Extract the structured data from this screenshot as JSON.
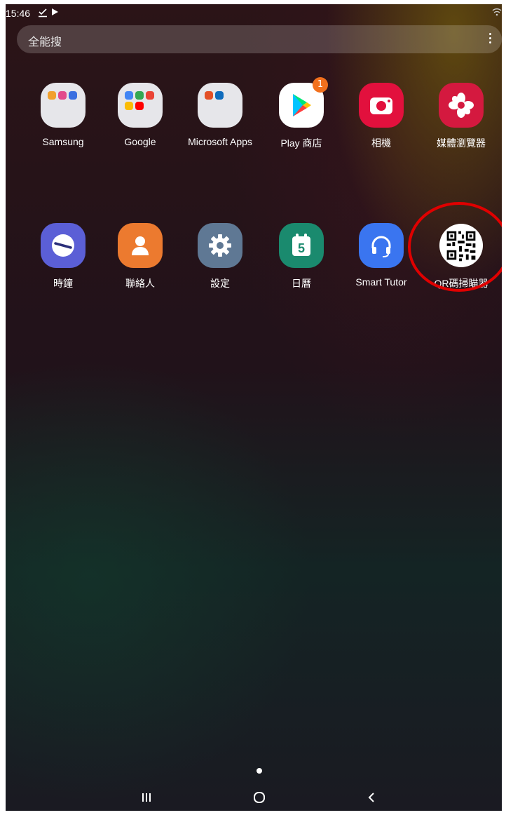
{
  "status": {
    "time": "15:46"
  },
  "search": {
    "placeholder": "全能搜"
  },
  "apps_row1": [
    {
      "label": "Samsung",
      "type": "folder"
    },
    {
      "label": "Google",
      "type": "folder"
    },
    {
      "label": "Microsoft Apps",
      "type": "folder"
    },
    {
      "label": "Play 商店",
      "badge": "1"
    },
    {
      "label": "相機"
    },
    {
      "label": "媒體瀏覽器"
    }
  ],
  "apps_row2": [
    {
      "label": "時鐘"
    },
    {
      "label": "聯絡人"
    },
    {
      "label": "設定"
    },
    {
      "label": "日曆",
      "day": "5"
    },
    {
      "label": "Smart Tutor"
    },
    {
      "label": "QR碼掃瞄器"
    }
  ],
  "colors": {
    "camera": "#e2103d",
    "gallery": "#d4193f",
    "clock": "#5b5fd6",
    "contacts": "#ec7a2f",
    "settings": "#5f7894",
    "calendar": "#1a8a6e",
    "smart_tutor": "#3a75f0",
    "highlight": "#e00000",
    "badge": "#f2701d"
  },
  "icons": {
    "status": [
      "download-done-icon",
      "play-store-icon",
      "wifi-icon"
    ],
    "nav": [
      "recent-apps-icon",
      "home-icon",
      "back-icon"
    ]
  }
}
